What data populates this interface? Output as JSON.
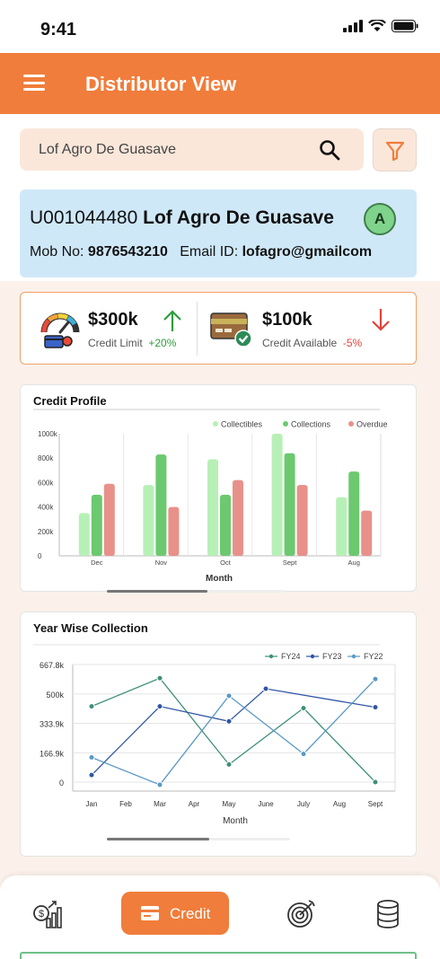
{
  "status_bar": {
    "time": "9:41"
  },
  "app_bar": {
    "title": "Distributor View"
  },
  "search": {
    "value": "Lof Agro De Guasave"
  },
  "distributor": {
    "code": "U001044480",
    "name": "Lof Agro De Guasave",
    "avatar_letter": "A",
    "mobile_label": "Mob No:",
    "mobile": "9876543210",
    "email_label": "Email ID:",
    "email": "lofagro@gmailcom"
  },
  "credit_summary": {
    "credit_limit": {
      "value": "$300k",
      "label": "Credit Limit",
      "change": "+20%",
      "direction": "up"
    },
    "credit_available": {
      "value": "$100k",
      "label": "Credit Available",
      "change": "-5%",
      "direction": "down"
    }
  },
  "colors": {
    "accent": "#f07d3b",
    "collectibles": "#b7f0b7",
    "collections": "#6cc96f",
    "overdue": "#e8918a",
    "fy24": "#3e8f7a",
    "fy23": "#2f55a4",
    "fy22": "#5a98c6"
  },
  "chart_data": [
    {
      "type": "bar",
      "title": "Credit Profile",
      "xlabel": "Month",
      "ylabel": "",
      "categories": [
        "Dec",
        "Nov",
        "Oct",
        "Sept",
        "Aug"
      ],
      "ylim": [
        0,
        1000
      ],
      "y_ticks": [
        "0",
        "200k",
        "400k",
        "600k",
        "800k",
        "1000k"
      ],
      "legend_position": "top-right",
      "series": [
        {
          "name": "Collectibles",
          "values": [
            350,
            580,
            790,
            1000,
            480
          ]
        },
        {
          "name": "Collections",
          "values": [
            500,
            830,
            500,
            840,
            690
          ]
        },
        {
          "name": "Overdue",
          "values": [
            590,
            400,
            620,
            580,
            370
          ]
        }
      ]
    },
    {
      "type": "line",
      "title": "Year Wise Collection",
      "xlabel": "Month",
      "ylabel": "",
      "categories": [
        "Jan",
        "Feb",
        "Mar",
        "Apr",
        "May",
        "June",
        "July",
        "Aug",
        "Sept"
      ],
      "ylim": [
        0,
        667.8
      ],
      "y_ticks": [
        "0",
        "166.9k",
        "333.9k",
        "500k",
        "667.8k"
      ],
      "legend_position": "top-right",
      "series": [
        {
          "name": "FY24",
          "points": [
            [
              "Jan",
              430
            ],
            [
              "Mar",
              590
            ],
            [
              "May",
              100
            ],
            [
              "July",
              420
            ],
            [
              "Sept",
              0
            ]
          ]
        },
        {
          "name": "FY23",
          "points": [
            [
              "Jan",
              40
            ],
            [
              "Mar",
              430
            ],
            [
              "May",
              345
            ],
            [
              "June",
              530
            ],
            [
              "Sept",
              425
            ]
          ]
        },
        {
          "name": "FY22",
          "points": [
            [
              "Jan",
              140
            ],
            [
              "Mar",
              -15
            ],
            [
              "May",
              490
            ],
            [
              "July",
              160
            ],
            [
              "Sept",
              585
            ]
          ]
        }
      ]
    }
  ],
  "bottom_nav": {
    "items": [
      {
        "icon": "finance-growth-icon"
      },
      {
        "icon": "credit-card-icon",
        "label": "Credit",
        "active": true
      },
      {
        "icon": "target-icon"
      },
      {
        "icon": "database-icon"
      }
    ]
  }
}
